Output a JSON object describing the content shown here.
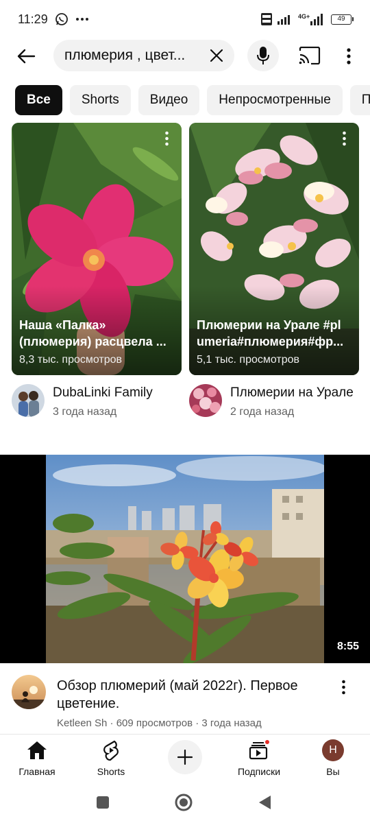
{
  "status_bar": {
    "time": "11:29",
    "network": "4G+",
    "battery": "49",
    "icons": [
      "whatsapp-icon",
      "more-dots-icon",
      "volte-icon",
      "signal-icon",
      "battery-icon"
    ]
  },
  "search": {
    "query": "плюмерия , цвет...",
    "icons": [
      "back-arrow-icon",
      "clear-icon",
      "mic-icon",
      "cast-icon",
      "more-vertical-icon"
    ]
  },
  "chips": [
    "Все",
    "Shorts",
    "Видео",
    "Непросмотренные",
    "П"
  ],
  "shorts": [
    {
      "title_line1": "Наша «Палка»",
      "title_line2": "(плюмерия) расцвела ...",
      "views": "8,3 тыс. просмотров",
      "channel": "DubaLinki Family",
      "date": "3 года назад"
    },
    {
      "title_line1": "Плюмерии на Урале #pl",
      "title_line2": "umeria#плюмерия#фр...",
      "views": "5,1 тыс. просмотров",
      "channel": "Плюмерии на Урале",
      "date": "2 года назад"
    }
  ],
  "video": {
    "duration": "8:55",
    "title": "Обзор плюмерий (май 2022г). Первое цветение.",
    "meta": "Ketleen Sh · 609 просмотров · 3 года назад"
  },
  "bottom_nav": {
    "home": "Главная",
    "shorts": "Shorts",
    "subscriptions": "Подписки",
    "you": "Вы",
    "you_initial": "Н"
  },
  "colors": {
    "chip_active_bg": "#0f0f0f",
    "chip_bg": "#f2f2f2",
    "notification_dot": "#e52d27",
    "avatar_you": "#7a3b2e"
  }
}
